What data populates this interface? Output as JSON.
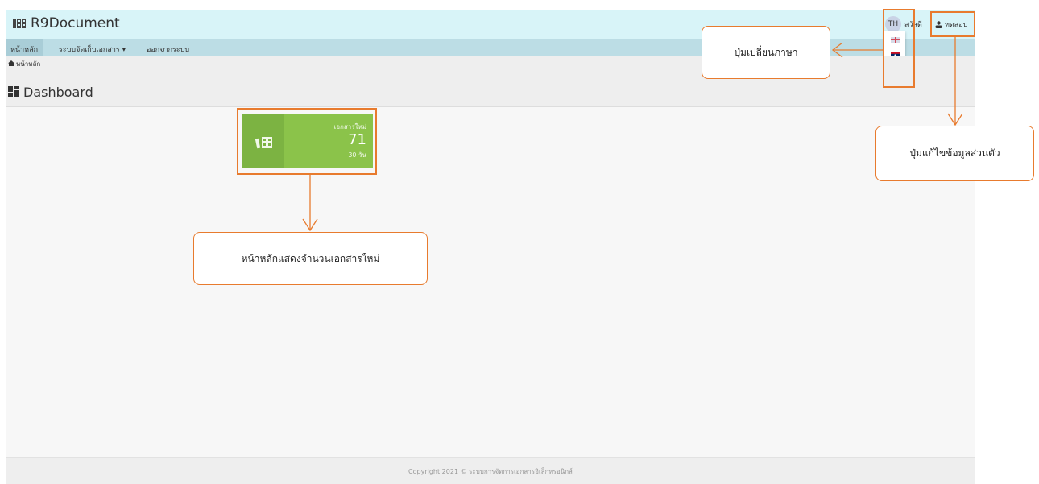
{
  "app": {
    "brand": "R9Document",
    "lang_toggle": "TH",
    "greeting": "สวัสดี",
    "username": "ทดสอบ",
    "lang_flags": [
      "English",
      "Lao",
      "Thai"
    ]
  },
  "nav": {
    "home": "หน้าหลัก",
    "documents": "ระบบจัดเก็บเอกสาร",
    "logout": "ออกจากระบบ"
  },
  "breadcrumb": {
    "home": "หน้าหลัก"
  },
  "page": {
    "title": "Dashboard"
  },
  "tile": {
    "label": "เอกสารใหม่",
    "value": "71",
    "sub": "30 วัน",
    "color": "#8bc34a"
  },
  "footer": {
    "text": "Copyright 2021 © ระบบการจัดการเอกสารอิเล็กทรอนิกส์"
  },
  "annotations": {
    "language_button": "ปุ่มเปลี่ยนภาษา",
    "profile_button": "ปุ่มแก้ไขข้อมูลส่วนตัว",
    "dashboard_note": "หน้าหลักแสดงจำนวนเอกสารใหม่",
    "accent": "#e87b2e"
  }
}
